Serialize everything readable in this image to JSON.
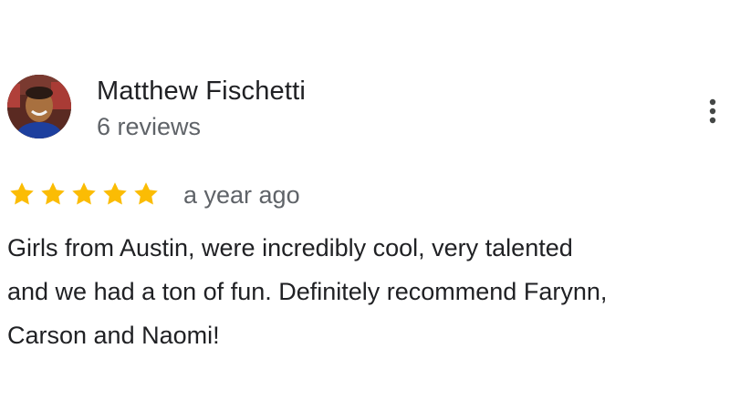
{
  "review": {
    "author": {
      "name": "Matthew Fischetti",
      "reviews_count": "6 reviews",
      "avatar_icon": "user-avatar-photo"
    },
    "more_icon": "more-vertical-icon",
    "rating": 5,
    "rating_max": 5,
    "star_color": "#fbbc04",
    "date": "a year ago",
    "text_lines": [
      "Girls from Austin, were incredibly cool, very talented",
      "and we had a ton of fun. Definitely recommend Farynn,",
      "Carson and Naomi!"
    ]
  }
}
